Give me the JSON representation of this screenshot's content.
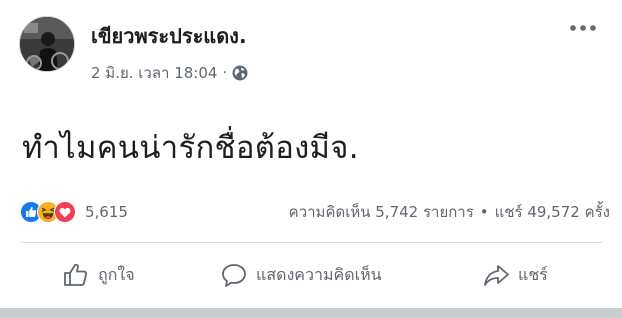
{
  "post": {
    "author": "เขียวพระประแดง.",
    "date": "2 มิ.ย. เวลา 18:04",
    "separator": "·",
    "message": "ทำไมคนน่ารักชื่อต้องมีจ.",
    "reactions": {
      "icons": [
        "like-reaction-icon",
        "haha-reaction-icon",
        "love-reaction-icon"
      ],
      "count": "5,615"
    },
    "comments": "ความคิดเห็น 5,742 รายการ",
    "stats_separator": "•",
    "shares": "แชร์ 49,572 ครั้ง"
  },
  "actions": {
    "like": "ถูกใจ",
    "comment": "แสดงความคิดเห็น",
    "share": "แชร์"
  },
  "colors": {
    "text": "#1c1e21",
    "secondary": "#606770",
    "like_blue": "#1877f2",
    "haha_yellow": "#f7b125",
    "love_red": "#f33e58",
    "divider": "#dadde1"
  }
}
